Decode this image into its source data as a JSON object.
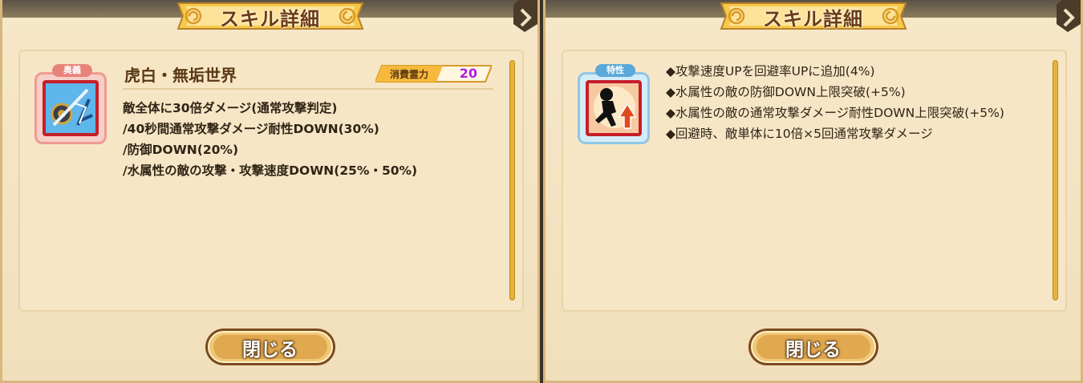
{
  "left_panel": {
    "title": "スキル詳細",
    "badge": "奥義",
    "skill_name": "虎白・無垢世界",
    "cost_label": "消費霊力",
    "cost_value": "20",
    "description": [
      "敵全体に30倍ダメージ(通常攻撃判定)",
      "/40秒間通常攻撃ダメージ耐性DOWN(30%)",
      "/防御DOWN(20%)",
      "/水属性の敵の攻撃・攻撃速度DOWN(25%・50%)"
    ],
    "close_label": "閉じる",
    "icon": "twin-blades-emblem-icon"
  },
  "right_panel": {
    "title": "スキル詳細",
    "badge": "特性",
    "traits": [
      "◆攻撃速度UPを回避率UPに追加(4%)",
      "◆水属性の敵の防御DOWN上限突破(+5%)",
      "◆水属性の敵の通常攻撃ダメージ耐性DOWN上限突破(+5%)",
      "◆回避時、敵単体に10倍×5回通常攻撃ダメージ"
    ],
    "close_label": "閉じる",
    "icon": "dodge-speed-up-icon"
  },
  "colors": {
    "panel_bg": "#f2e0bd",
    "title_text": "#6b3b14",
    "badge_ougi": "#e8837a",
    "badge_trait": "#5aa9d8",
    "cost_value": "#b01fd6",
    "scrollbar": "#e6b43a"
  }
}
